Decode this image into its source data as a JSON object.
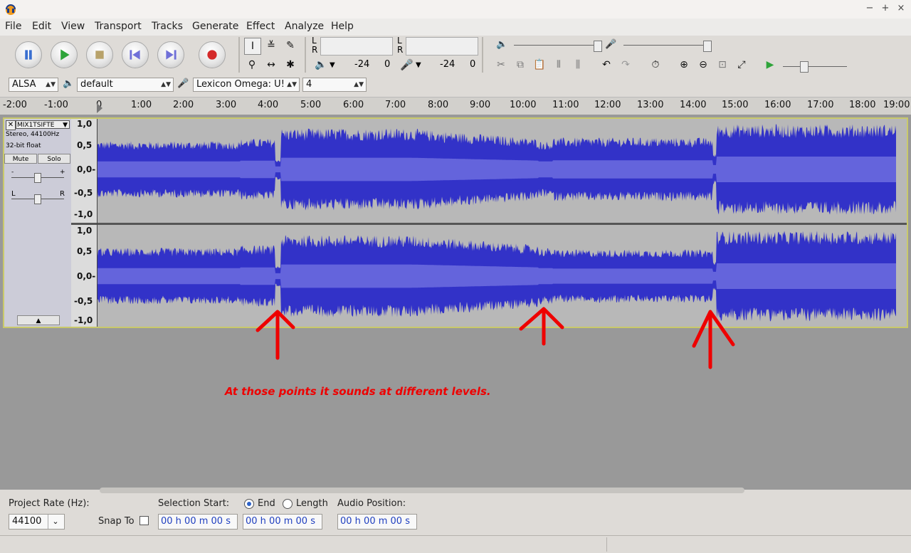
{
  "menu": [
    "File",
    "Edit",
    "View",
    "Transport",
    "Tracks",
    "Generate",
    "Effect",
    "Analyze",
    "Help"
  ],
  "window_controls": {
    "minimize": "−",
    "maximize": "+",
    "close": "×"
  },
  "meters": {
    "l": "L",
    "r": "R",
    "play_db": "-24",
    "rec_zero": "0",
    "rec_db": "-24",
    "rec_zero2": "0"
  },
  "device": {
    "host": "ALSA",
    "output": "default",
    "input": "Lexicon Omega: U!",
    "channels": "4"
  },
  "ruler": [
    "-2:00",
    "-1:00",
    "0",
    "1:00",
    "2:00",
    "3:00",
    "4:00",
    "5:00",
    "6:00",
    "7:00",
    "8:00",
    "9:00",
    "10:00",
    "11:00",
    "12:00",
    "13:00",
    "14:00",
    "15:00",
    "16:00",
    "17:00",
    "18:00",
    "19:00"
  ],
  "track": {
    "name": "MIX1TSIFTE",
    "format": "Stereo, 44100Hz",
    "bits": "32-bit float",
    "mute": "Mute",
    "solo": "Solo",
    "gain_minus": "-",
    "gain_plus": "+",
    "pan_l": "L",
    "pan_r": "R",
    "scale": [
      "1,0",
      "0,5",
      "0,0-",
      "-0,5",
      "-1,0"
    ]
  },
  "annotation": "At those points it sounds at different levels.",
  "selection": {
    "project_rate_label": "Project Rate (Hz):",
    "project_rate": "44100",
    "snap_to": "Snap To",
    "selection_start": "Selection Start:",
    "end": "End",
    "length": "Length",
    "audio_position": "Audio Position:",
    "time_start": "00 h 00 m 00 s",
    "time_end": "00 h 00 m 00 s",
    "time_pos": "00 h 00 m 00 s"
  },
  "colors": {
    "wave_dark": "#3232c8",
    "wave_rms": "#6464dc",
    "annotation": "#ee0000",
    "track_border": "#c9c96a"
  }
}
